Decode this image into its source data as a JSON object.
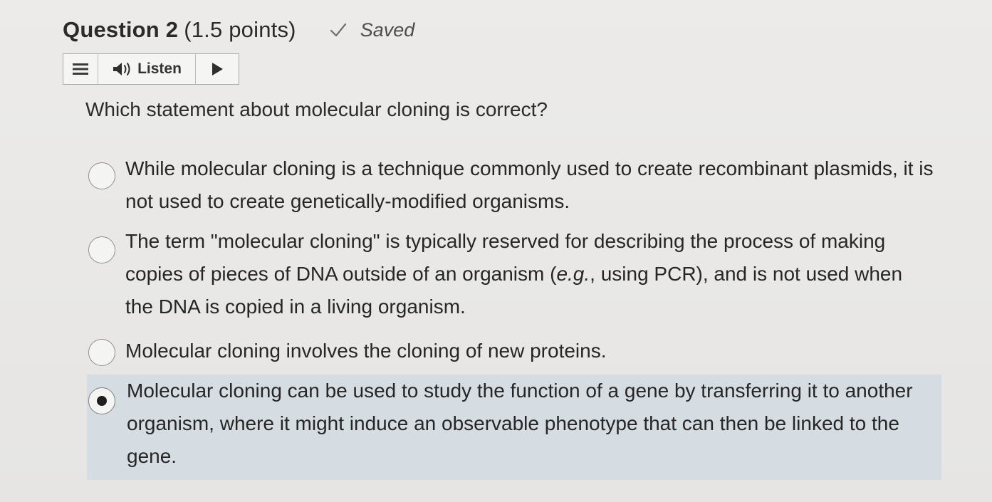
{
  "question": {
    "number_label": "Question 2",
    "points_label": "(1.5 points)",
    "saved_label": "Saved",
    "prompt": "Which statement about molecular cloning is correct?"
  },
  "listen_bar": {
    "listen_label": "Listen"
  },
  "icons": {
    "menu": "hamburger-menu-icon",
    "speaker": "speaker-icon",
    "play": "play-icon",
    "check": "checkmark-icon"
  },
  "options": [
    {
      "text": "While molecular cloning is a technique commonly used to create recombinant plasmids, it is not used to create genetically-modified organisms.",
      "selected": false
    },
    {
      "text_before": "The term \"molecular cloning\" is typically reserved for describing the process of making copies of pieces of DNA outside of an organism (",
      "text_italic": "e.g.",
      "text_after": ", using PCR), and is not used when the DNA is copied in a living organism.",
      "selected": false
    },
    {
      "text": "Molecular cloning involves the cloning of new proteins.",
      "selected": false
    },
    {
      "text": "Molecular cloning can be used to study the function of a gene by transferring it to another organism, where it might induce an observable phenotype that can then be linked to the gene.",
      "selected": true
    }
  ],
  "colors": {
    "background": "#e9e8e6",
    "selected_option_bg": "#d5dce2",
    "text": "#2b2b2b"
  }
}
